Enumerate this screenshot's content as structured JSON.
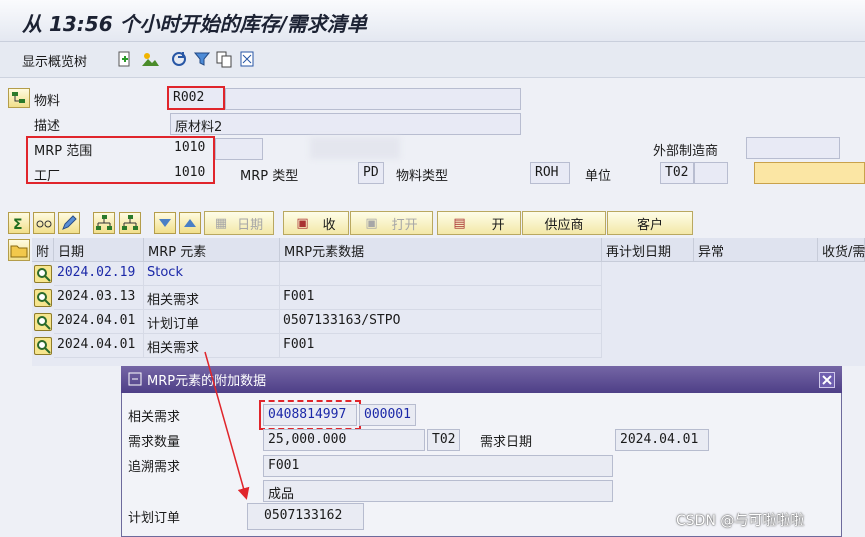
{
  "title": "从 13:56 个小时开始的库存/需求清单",
  "toolbar": {
    "overview_tree": "显示概览树"
  },
  "header": {
    "material_label": "物料",
    "material_value": "R002",
    "desc_label": "描述",
    "desc_value": "原材料2",
    "mrp_area_label": "MRP 范围",
    "mrp_area_value": "1010",
    "plant_label": "工厂",
    "plant_value": "1010",
    "mrp_type_label": "MRP 类型",
    "mrp_type_value": "PD",
    "mat_type_label": "物料类型",
    "mat_type_value": "ROH",
    "unit_label": "单位",
    "unit_value": "T02",
    "ext_mfr_label": "外部制造商"
  },
  "buttons": {
    "date": "日期",
    "receipts": "收",
    "open": "打开",
    "open2": "开",
    "supplier": "供应商",
    "customer": "客户"
  },
  "table": {
    "headers": [
      "附",
      "日期",
      "MRP 元素",
      "MRP元素数据",
      "再计划日期",
      "异常",
      "收货/需"
    ],
    "rows": [
      {
        "date": "2024.02.19",
        "element": "Stock",
        "data": ""
      },
      {
        "date": "2024.03.13",
        "element": "相关需求",
        "data": "F001"
      },
      {
        "date": "2024.04.01",
        "element": "计划订单",
        "data": "0507133163/STPO"
      },
      {
        "date": "2024.04.01",
        "element": "相关需求",
        "data": "F001"
      }
    ]
  },
  "popup": {
    "title": "MRP元素的附加数据",
    "dep_req_label": "相关需求",
    "dep_req_value": "0408814997",
    "dep_req_item": "000001",
    "req_qty_label": "需求数量",
    "req_qty_value": "25,000.000",
    "req_qty_unit": "T02",
    "req_date_label": "需求日期",
    "req_date_value": "2024.04.01",
    "pegged_label": "追溯需求",
    "pegged_value": "F001",
    "pegged_desc": "成品",
    "plan_order_label": "计划订单",
    "plan_order_value": "0507133162"
  },
  "watermark": "CSDN @与可啦啦啦"
}
